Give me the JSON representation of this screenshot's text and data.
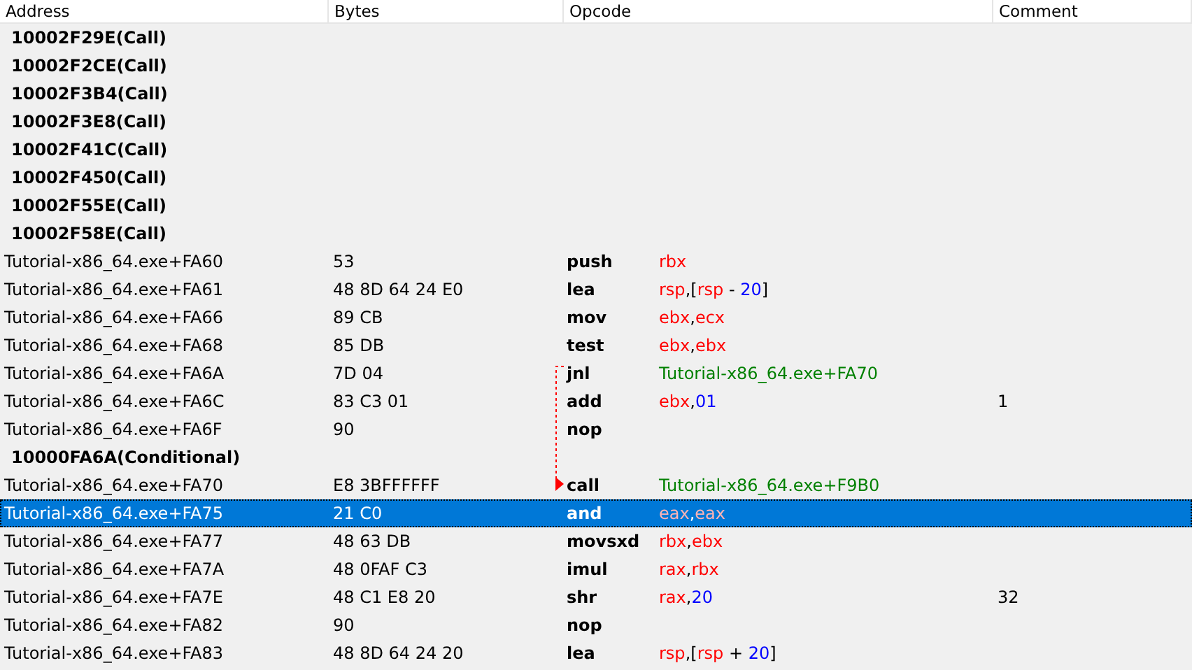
{
  "columns": [
    "Address",
    "Bytes",
    "Opcode",
    "Comment"
  ],
  "rows": [
    {
      "kind": "reference",
      "label": "10002F29E(Call)",
      "selected": false
    },
    {
      "kind": "reference",
      "label": "10002F2CE(Call)",
      "selected": false
    },
    {
      "kind": "reference",
      "label": "10002F3B4(Call)",
      "selected": false
    },
    {
      "kind": "reference",
      "label": "10002F3E8(Call)",
      "selected": false
    },
    {
      "kind": "reference",
      "label": "10002F41C(Call)",
      "selected": false
    },
    {
      "kind": "reference",
      "label": "10002F450(Call)",
      "selected": false
    },
    {
      "kind": "reference",
      "label": "10002F55E(Call)",
      "selected": false
    },
    {
      "kind": "reference",
      "label": "10002F58E(Call)",
      "selected": false
    },
    {
      "kind": "instruction",
      "address": "Tutorial-x86_64.exe+FA60",
      "bytes": "53",
      "mnemonic": "push",
      "operands": [
        {
          "text": "rbx",
          "kind": "register"
        }
      ],
      "selected": false
    },
    {
      "kind": "instruction",
      "address": "Tutorial-x86_64.exe+FA61",
      "bytes": "48 8D 64 24 E0",
      "mnemonic": "lea",
      "operands": [
        {
          "text": "rsp",
          "kind": "register"
        },
        {
          "text": ",[",
          "kind": "punct"
        },
        {
          "text": "rsp",
          "kind": "register"
        },
        {
          "text": " - ",
          "kind": "punct"
        },
        {
          "text": "20",
          "kind": "number"
        },
        {
          "text": "]",
          "kind": "punct"
        }
      ],
      "selected": false
    },
    {
      "kind": "instruction",
      "address": "Tutorial-x86_64.exe+FA66",
      "bytes": "89 CB",
      "mnemonic": "mov",
      "operands": [
        {
          "text": "ebx",
          "kind": "register"
        },
        {
          "text": ",",
          "kind": "punct"
        },
        {
          "text": "ecx",
          "kind": "register"
        }
      ],
      "selected": false
    },
    {
      "kind": "instruction",
      "address": "Tutorial-x86_64.exe+FA68",
      "bytes": "85 DB",
      "mnemonic": "test",
      "operands": [
        {
          "text": "ebx",
          "kind": "register"
        },
        {
          "text": ",",
          "kind": "punct"
        },
        {
          "text": "ebx",
          "kind": "register"
        }
      ],
      "selected": false
    },
    {
      "kind": "instruction",
      "address": "Tutorial-x86_64.exe+FA6A",
      "bytes": "7D 04",
      "mnemonic": "jnl",
      "operands": [
        {
          "text": "Tutorial-x86_64.exe+FA70",
          "kind": "symbol"
        }
      ],
      "jump_from": true,
      "selected": false
    },
    {
      "kind": "instruction",
      "address": "Tutorial-x86_64.exe+FA6C",
      "bytes": "83 C3 01",
      "mnemonic": "add",
      "operands": [
        {
          "text": "ebx",
          "kind": "register"
        },
        {
          "text": ",",
          "kind": "punct"
        },
        {
          "text": "01",
          "kind": "number"
        }
      ],
      "comment": "1",
      "selected": false
    },
    {
      "kind": "instruction",
      "address": "Tutorial-x86_64.exe+FA6F",
      "bytes": "90",
      "mnemonic": "nop",
      "operands": [],
      "selected": false
    },
    {
      "kind": "reference",
      "label": "10000FA6A(Conditional)",
      "selected": false
    },
    {
      "kind": "instruction",
      "address": "Tutorial-x86_64.exe+FA70",
      "bytes": "E8 3BFFFFFF",
      "mnemonic": "call",
      "operands": [
        {
          "text": "Tutorial-x86_64.exe+F9B0",
          "kind": "symbol"
        }
      ],
      "jump_to": true,
      "selected": false
    },
    {
      "kind": "instruction",
      "address": "Tutorial-x86_64.exe+FA75",
      "bytes": "21 C0",
      "mnemonic": "and",
      "operands": [
        {
          "text": "eax",
          "kind": "register"
        },
        {
          "text": ",",
          "kind": "punct"
        },
        {
          "text": "eax",
          "kind": "register"
        }
      ],
      "selected": true
    },
    {
      "kind": "instruction",
      "address": "Tutorial-x86_64.exe+FA77",
      "bytes": "48 63 DB",
      "mnemonic": "movsxd",
      "operands": [
        {
          "text": "rbx",
          "kind": "register"
        },
        {
          "text": ",",
          "kind": "punct"
        },
        {
          "text": "ebx",
          "kind": "register"
        }
      ],
      "selected": false
    },
    {
      "kind": "instruction",
      "address": "Tutorial-x86_64.exe+FA7A",
      "bytes": "48 0FAF C3",
      "mnemonic": "imul",
      "operands": [
        {
          "text": "rax",
          "kind": "register"
        },
        {
          "text": ",",
          "kind": "punct"
        },
        {
          "text": "rbx",
          "kind": "register"
        }
      ],
      "selected": false
    },
    {
      "kind": "instruction",
      "address": "Tutorial-x86_64.exe+FA7E",
      "bytes": "48 C1 E8 20",
      "mnemonic": "shr",
      "operands": [
        {
          "text": "rax",
          "kind": "register"
        },
        {
          "text": ",",
          "kind": "punct"
        },
        {
          "text": "20",
          "kind": "number"
        }
      ],
      "comment": "32",
      "selected": false
    },
    {
      "kind": "instruction",
      "address": "Tutorial-x86_64.exe+FA82",
      "bytes": "90",
      "mnemonic": "nop",
      "operands": [],
      "selected": false
    },
    {
      "kind": "instruction",
      "address": "Tutorial-x86_64.exe+FA83",
      "bytes": "48 8D 64 24 20",
      "mnemonic": "lea",
      "operands": [
        {
          "text": "rsp",
          "kind": "register"
        },
        {
          "text": ",[",
          "kind": "punct"
        },
        {
          "text": "rsp",
          "kind": "register"
        },
        {
          "text": " + ",
          "kind": "punct"
        },
        {
          "text": "20",
          "kind": "number"
        },
        {
          "text": "]",
          "kind": "punct"
        }
      ],
      "selected": false
    }
  ]
}
